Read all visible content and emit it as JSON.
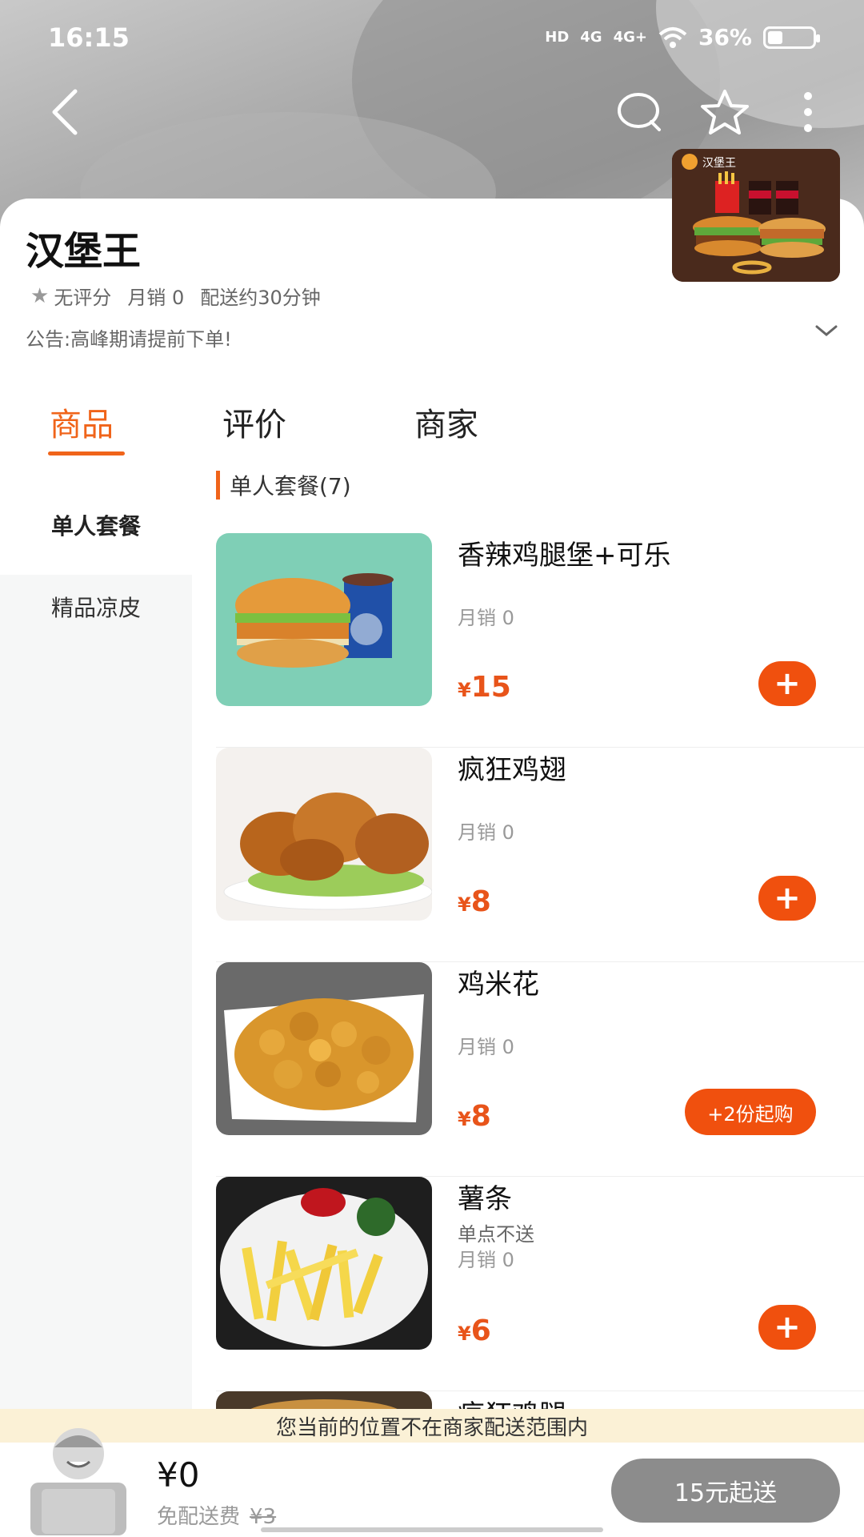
{
  "status_bar": {
    "time": "16:15",
    "network1": "HD",
    "network2": "4G",
    "network3": "4G+",
    "battery": "36%"
  },
  "nav": {
    "icons": [
      "back-icon",
      "search-icon",
      "star-icon",
      "more-icon"
    ]
  },
  "store": {
    "name": "汉堡王",
    "rating": "无评分",
    "monthly_sales": "月销 0",
    "delivery_time": "配送约30分钟",
    "notice": "公告:高峰期请提前下单!",
    "logo_text": "汉堡王"
  },
  "tabs": [
    {
      "label": "商品",
      "active": true
    },
    {
      "label": "评价",
      "active": false
    },
    {
      "label": "商家",
      "active": false
    }
  ],
  "categories": [
    {
      "label": "单人套餐",
      "active": true
    },
    {
      "label": "精品凉皮",
      "active": false
    }
  ],
  "section": {
    "title": "单人套餐(7)"
  },
  "items": [
    {
      "name": "香辣鸡腿堡+可乐",
      "sales": "月销 0",
      "currency": "¥",
      "price": "15",
      "action": "+"
    },
    {
      "name": "疯狂鸡翅",
      "sales": "月销 0",
      "currency": "¥",
      "price": "8",
      "action": "+"
    },
    {
      "name": "鸡米花",
      "sales": "月销 0",
      "currency": "¥",
      "price": "8",
      "action": "+2份起购"
    },
    {
      "name": "薯条",
      "note": "单点不送",
      "sales": "月销 0",
      "currency": "¥",
      "price": "6",
      "action": "+"
    },
    {
      "name": "疯狂鸡腿"
    }
  ],
  "banner": {
    "text": "您当前的位置不在商家配送范围内"
  },
  "cart": {
    "total": "¥0",
    "fee_label": "免配送费",
    "original_fee": "¥3",
    "checkout_label": "15元起送"
  },
  "colors": {
    "accent": "#f0641a",
    "button": "#f0500e",
    "price": "#e8541a",
    "checkout_disabled": "#8c8c8c",
    "banner_bg": "#fbf1d6"
  }
}
